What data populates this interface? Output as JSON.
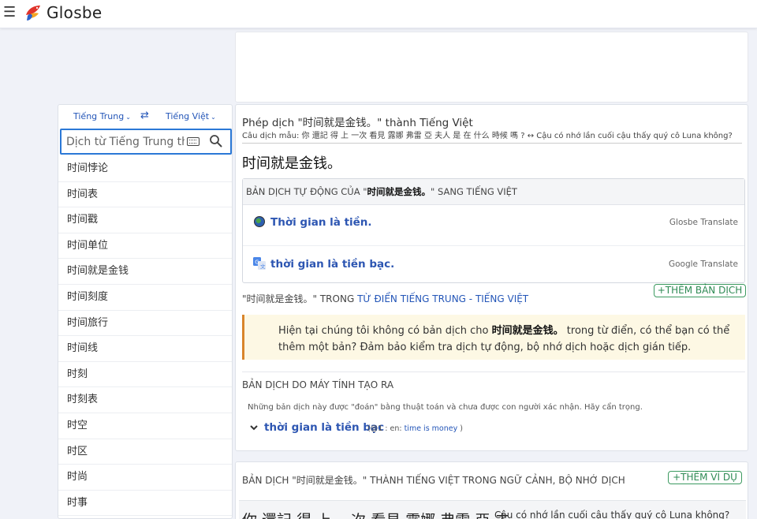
{
  "header": {
    "menu_icon": "hamburger-icon",
    "logo_icon": "glosbe-bird-icon",
    "logo_text": "Glosbe"
  },
  "sidebar": {
    "source_language": "Tiếng Trung",
    "target_language": "Tiếng Việt",
    "swap_icon": "swap-arrows-icon",
    "search_placeholder": "Dịch từ Tiếng Trung thành Tiếng Việt",
    "keyboard_icon": "keyboard-icon",
    "search_icon": "search-icon",
    "words": [
      "时间悖论",
      "时间表",
      "时间戳",
      "时间单位",
      "时间就是金钱",
      "时间刻度",
      "时间旅行",
      "时间线",
      "时刻",
      "时刻表",
      "时空",
      "时区",
      "时尚",
      "时事"
    ]
  },
  "main": {
    "title": "Phép dịch \"时间就是金钱。\" thành Tiếng Việt",
    "example": "Câu dịch mẫu: 你 還記 得 上 一次 看見 露娜 弗雷 亞 夫人 是 在 什么 時候 嗎 ? ↔ Cậu có nhớ lần cuối cậu thấy quý cô Luna không?",
    "headword": "时间就是金钱。",
    "auto": {
      "heading_prefix": "BẢN DỊCH TỰ ĐỘNG CỦA \"",
      "heading_term": "时间就是金钱。",
      "heading_suffix": "\" SANG TIẾNG VIỆT",
      "rows": [
        {
          "icon": "globe-icon",
          "term": "Thời gian là tiền.",
          "engine": "Glosbe Translate"
        },
        {
          "icon": "google-translate-icon",
          "term": "thời gian là tiền bạc.",
          "engine": "Google Translate"
        }
      ]
    },
    "add_translation_label": "+THÊM BẢN DỊCH",
    "dict_prefix": "\"时间就是金钱。\" TRONG ",
    "dict_link": "TỪ ĐIỂN TIẾNG TRUNG - TIẾNG VIỆT",
    "notice": {
      "part1": "Hiện tại chúng tôi không có bản dịch cho ",
      "term": "时间就是金钱。",
      "part2": " trong từ điển, có thể bạn có thể thêm một bản? Đảm bảo kiểm tra dịch tự động, bộ nhớ dịch hoặc dịch gián tiếp."
    },
    "machine": {
      "heading": "BẢN DỊCH DO MÁY TÍNH TẠO RA",
      "description": "Những bản dịch này được \"đoán\" bằng thuật toán và chưa được con người xác nhận. Hãy cẩn trọng.",
      "term": "thời gian là tiền bạc",
      "source_prefix": "(@1 : en: ",
      "source_link": "time is money",
      "source_suffix": " )"
    }
  },
  "context": {
    "heading": "BẢN DỊCH \"时间就是金钱。\" THÀNH TIẾNG VIỆT TRONG NGỮ CẢNH, BỘ NHỚ DỊCH",
    "add_example_label": "+THÊM VÍ DỤ",
    "example_source": "你 還記 得 上 一次 看見 露娜 弗雷 亞 夫",
    "example_target": "Cậu có nhớ lần cuối cậu thấy quý cô Luna không?"
  }
}
